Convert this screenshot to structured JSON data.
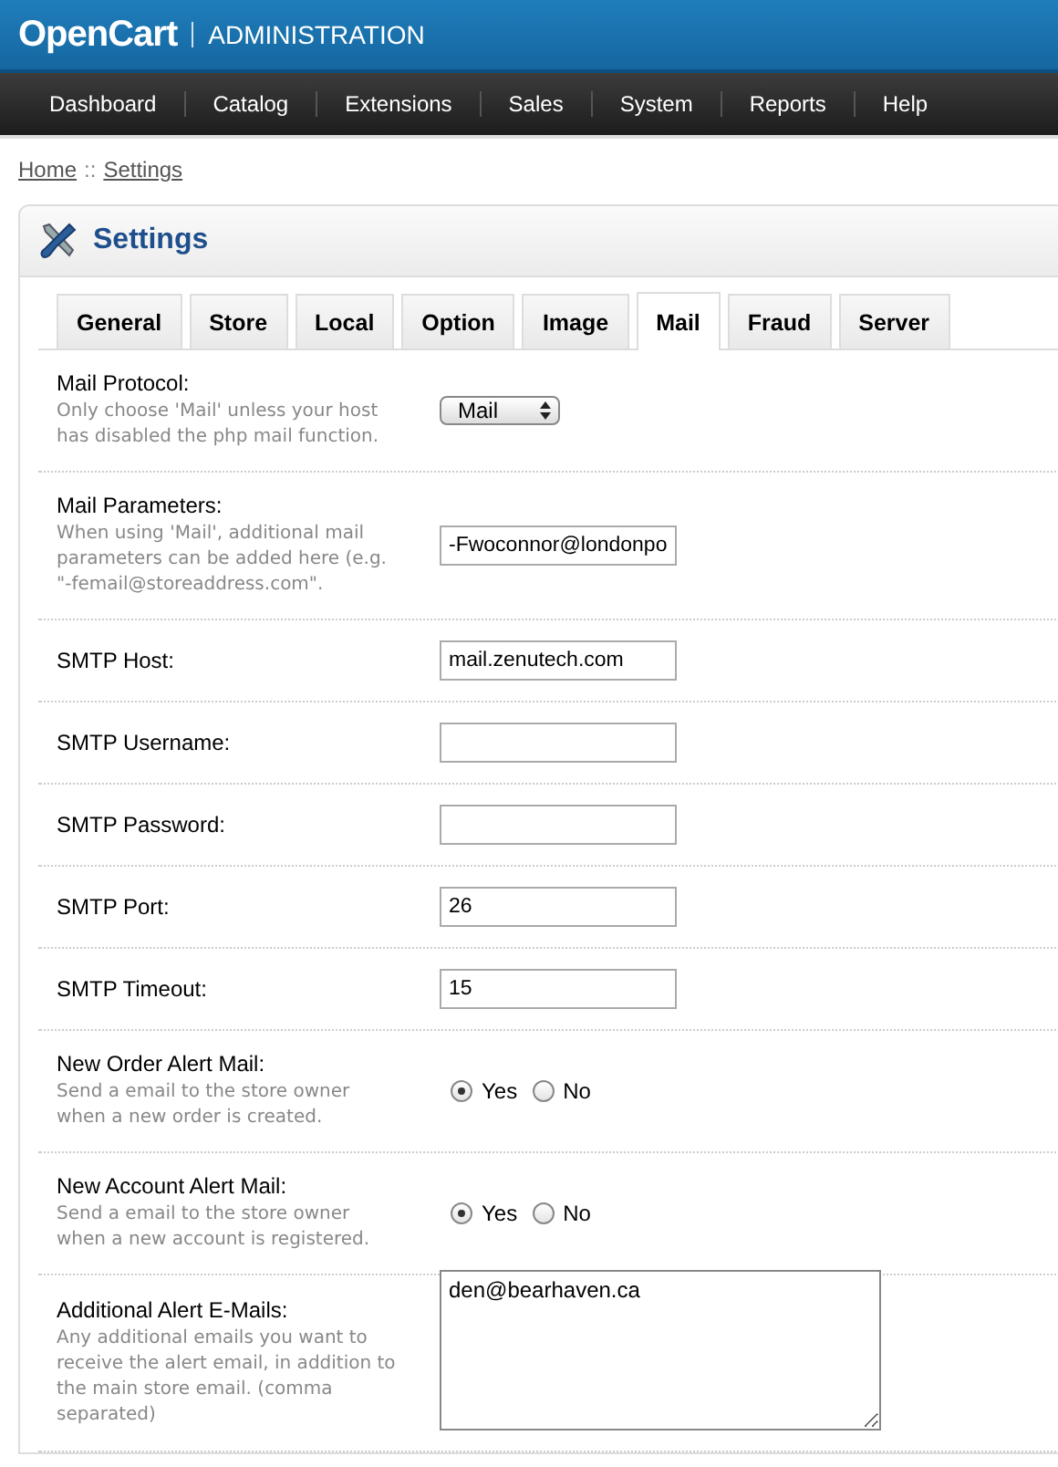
{
  "header": {
    "logo": "OpenCart",
    "title": "ADMINISTRATION"
  },
  "nav": [
    "Dashboard",
    "Catalog",
    "Extensions",
    "Sales",
    "System",
    "Reports",
    "Help"
  ],
  "breadcrumb": [
    "Home",
    "Settings"
  ],
  "breadcrumb_separator": "::",
  "panel": {
    "title": "Settings"
  },
  "tabs": [
    {
      "label": "General",
      "selected": false
    },
    {
      "label": "Store",
      "selected": false
    },
    {
      "label": "Local",
      "selected": false
    },
    {
      "label": "Option",
      "selected": false
    },
    {
      "label": "Image",
      "selected": false
    },
    {
      "label": "Mail",
      "selected": true
    },
    {
      "label": "Fraud",
      "selected": false
    },
    {
      "label": "Server",
      "selected": false
    }
  ],
  "fields": [
    {
      "kind": "select",
      "label": "Mail Protocol:",
      "help": "Only choose 'Mail' unless your host has disabled the php mail function.",
      "value": "Mail"
    },
    {
      "kind": "text",
      "label": "Mail Parameters:",
      "help": "When using 'Mail', additional mail parameters can be added here (e.g. \"-femail@storeaddress.com\".",
      "value": "-Fwoconnor@londonpo"
    },
    {
      "kind": "text",
      "label": "SMTP Host:",
      "value": "mail.zenutech.com"
    },
    {
      "kind": "text",
      "label": "SMTP Username:"
    },
    {
      "kind": "text",
      "label": "SMTP Password:"
    },
    {
      "kind": "text",
      "label": "SMTP Port:",
      "value": "26"
    },
    {
      "kind": "text",
      "label": "SMTP Timeout:",
      "value": "15"
    },
    {
      "kind": "radio",
      "label": "New Order Alert Mail:",
      "help": "Send a email to the store owner when a new order is created.",
      "options": [
        {
          "label": "Yes",
          "selected": true
        },
        {
          "label": "No",
          "selected": false
        }
      ]
    },
    {
      "kind": "radio",
      "label": "New Account Alert Mail:",
      "help": "Send a email to the store owner when a new account is registered.",
      "options": [
        {
          "label": "Yes",
          "selected": true
        },
        {
          "label": "No",
          "selected": false
        }
      ]
    },
    {
      "kind": "textarea",
      "label": "Additional Alert E-Mails:",
      "help": "Any additional emails you want to receive the alert email, in addition to the main store email. (comma separated)",
      "value": "den@bearhaven.ca"
    }
  ]
}
